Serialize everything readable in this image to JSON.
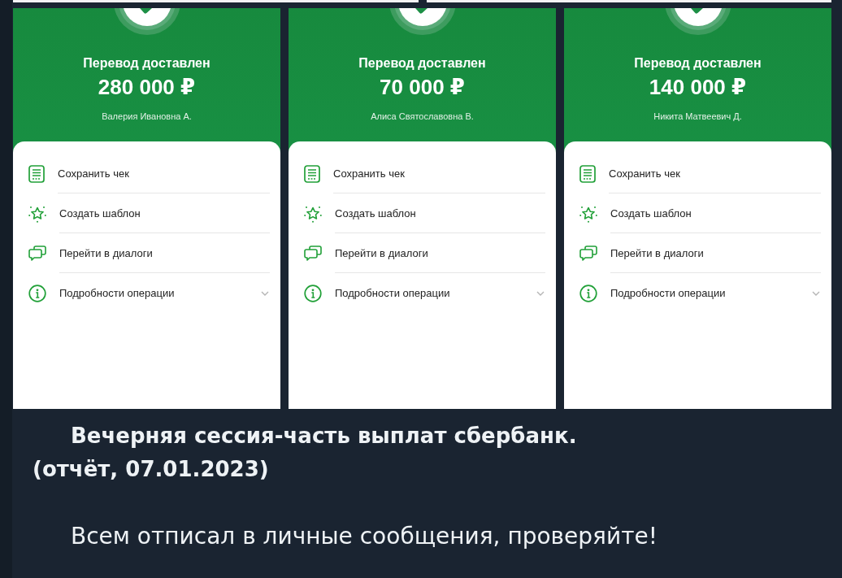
{
  "receipts": [
    {
      "status": "Перевод доставлен",
      "amount": "280 000 ₽",
      "recipient": "Валерия Ивановна А.",
      "actions": [
        {
          "kind": "receipt",
          "label": "Сохранить чек"
        },
        {
          "kind": "template",
          "label": "Создать шаблон"
        },
        {
          "kind": "dialogs",
          "label": "Перейти в диалоги"
        },
        {
          "kind": "details",
          "label": "Подробности операции",
          "expanded": false
        }
      ]
    },
    {
      "status": "Перевод доставлен",
      "amount": "70 000 ₽",
      "recipient": "Алиса Святославовна В.",
      "actions": [
        {
          "kind": "receipt",
          "label": "Сохранить чек"
        },
        {
          "kind": "template",
          "label": "Создать шаблон"
        },
        {
          "kind": "dialogs",
          "label": "Перейти в диалоги"
        },
        {
          "kind": "details",
          "label": "Подробности операции",
          "expanded": false
        }
      ]
    },
    {
      "status": "Перевод доставлен",
      "amount": "140 000 ₽",
      "recipient": "Никита Матвеевич Д.",
      "actions": [
        {
          "kind": "receipt",
          "label": "Сохранить чек"
        },
        {
          "kind": "template",
          "label": "Создать шаблон"
        },
        {
          "kind": "dialogs",
          "label": "Перейти в диалоги"
        },
        {
          "kind": "details",
          "label": "Подробности операции",
          "expanded": false
        }
      ]
    }
  ],
  "caption": {
    "heading": "Вечерняя сессия-часть выплат сбербанк.\n(отчёт, 07.01.2023)",
    "text": "Всем отписал в личные сообщения, проверяйте!"
  }
}
